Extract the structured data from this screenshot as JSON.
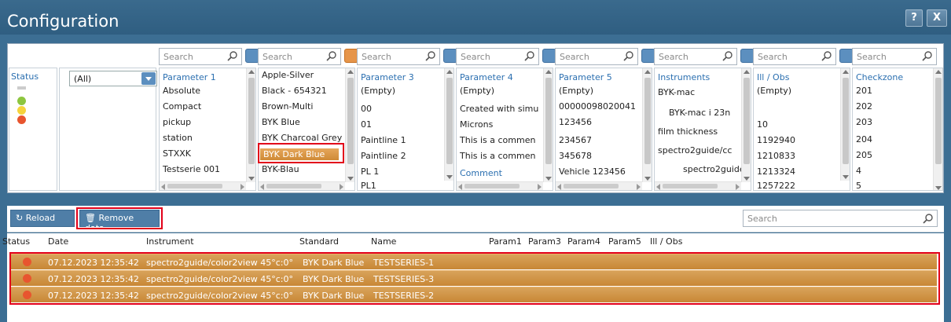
{
  "window": {
    "title": "Configuration",
    "help_label": "?",
    "close_label": "X"
  },
  "filters": {
    "search_placeholder": "Search",
    "status": {
      "label": "Status",
      "items": [
        {
          "kind": "dash",
          "color": "#cccccc"
        },
        {
          "kind": "dot",
          "color": "#8dc63f"
        },
        {
          "kind": "dot",
          "color": "#f5d33c"
        },
        {
          "kind": "dot",
          "color": "#e8552f"
        }
      ]
    },
    "combo_value": "(All)",
    "param1": {
      "header": "Parameter 1",
      "items": [
        "Absolute",
        "Compact",
        "pickup",
        "station",
        "STXXK",
        "Testserie 001"
      ]
    },
    "param2": {
      "items": [
        "Apple-Silver",
        "Black - 654321",
        "Brown-Multi",
        "BYK Blue",
        "BYK Charcoal Grey",
        "BYK Dark Blue",
        "BYK-Blau"
      ]
    },
    "param3": {
      "header": "Parameter 3",
      "items": [
        "(Empty)",
        "00",
        "01",
        "Paintline 1",
        "Paintline 2",
        "PL 1",
        "PL1"
      ]
    },
    "param4": {
      "header": "Parameter 4",
      "items": [
        "(Empty)",
        "Created with simu",
        "Microns",
        "This is a commen",
        "This is a commen",
        "Comment"
      ]
    },
    "param5": {
      "header": "Parameter 5",
      "items": [
        "(Empty)",
        "00000098020041",
        "123456",
        "234567",
        "345678",
        "Vehicle 123456"
      ]
    },
    "instruments": {
      "header": "Instruments",
      "items": [
        "BYK-mac",
        "BYK-mac i 23n",
        "film thickness",
        "spectro2guide/cc",
        "spectro2guide"
      ]
    },
    "ill_obs": {
      "header": "Ill / Obs",
      "items": [
        "(Empty)",
        "10",
        "1192940",
        "1210833",
        "1213324",
        "1257222"
      ]
    },
    "checkzone": {
      "header": "Checkzone",
      "items": [
        "201",
        "202",
        "203",
        "204",
        "205",
        "4",
        "5"
      ]
    }
  },
  "toolbar": {
    "reload_label": "Reload",
    "remove_label": "Remove data",
    "search_placeholder": "Search"
  },
  "grid": {
    "columns": [
      "Status",
      "Date",
      "Instrument",
      "Standard",
      "Name",
      "Param1",
      "Param3",
      "Param4",
      "Param5",
      "Ill / Obs"
    ],
    "rows": [
      {
        "date": "07.12.2023 12:35:42",
        "instrument": "spectro2guide/color2view 45°c:0°",
        "standard": "BYK Dark Blue",
        "name": "TESTSERIES-1"
      },
      {
        "date": "07.12.2023 12:35:42",
        "instrument": "spectro2guide/color2view 45°c:0°",
        "standard": "BYK Dark Blue",
        "name": "TESTSERIES-3"
      },
      {
        "date": "07.12.2023 12:35:42",
        "instrument": "spectro2guide/color2view 45°c:0°",
        "standard": "BYK Dark Blue",
        "name": "TESTSERIES-2"
      }
    ]
  }
}
